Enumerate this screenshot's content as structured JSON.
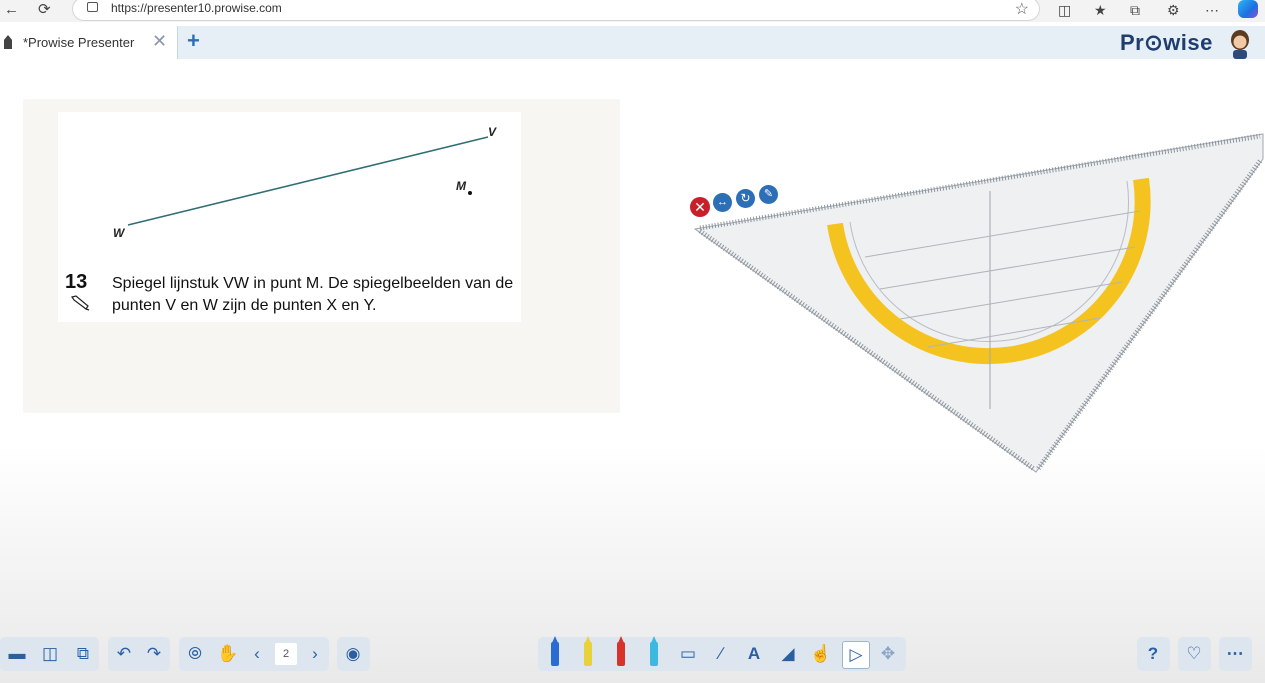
{
  "browser": {
    "url": "https://presenter10.prowise.com"
  },
  "app": {
    "tab_label": "*Prowise Presenter",
    "logo": "Pr⊙wise"
  },
  "worksheet": {
    "point_v": "V",
    "point_w": "W",
    "point_m": "M",
    "question_number": "13",
    "question_line1": "Spiegel lijnstuk VW in punt M. De spiegelbeelden van de",
    "question_line2": "punten V en W zijn de punten X en Y."
  },
  "triangle_tool": {
    "controls": [
      "close-icon",
      "rotate-icon",
      "reset-icon",
      "pen-icon"
    ]
  },
  "toolbar": {
    "page_number": "2",
    "colors": {
      "accent": "#2a5fa0",
      "pen_blue": "#2b6cd4",
      "pen_yellow": "#e8d23a",
      "pen_red": "#d9312b",
      "pen_cyan": "#3db8e0"
    }
  }
}
